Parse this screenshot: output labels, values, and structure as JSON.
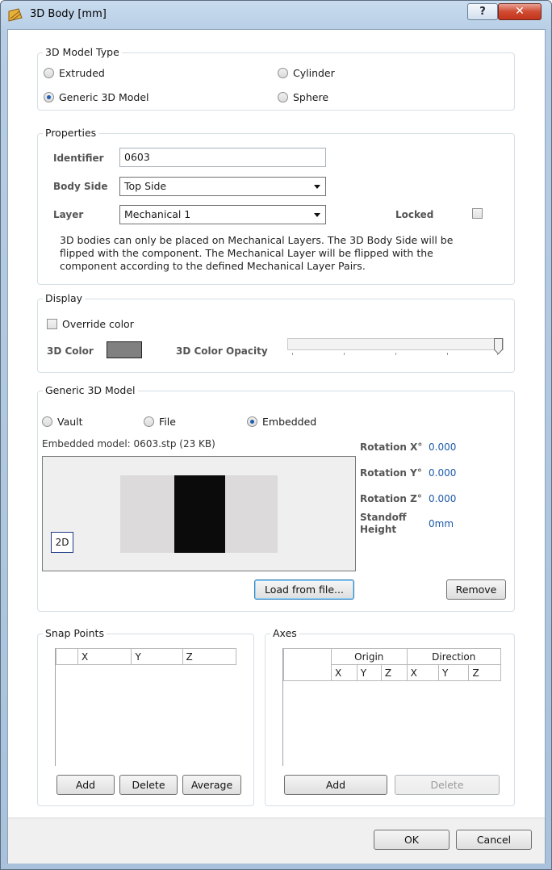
{
  "window": {
    "title": "3D Body [mm]",
    "help_label": "?",
    "close_label": "✕"
  },
  "model_type": {
    "legend": "3D Model Type",
    "options": [
      "Extruded",
      "Cylinder",
      "Generic 3D Model",
      "Sphere"
    ],
    "selected": "Generic 3D Model"
  },
  "properties": {
    "legend": "Properties",
    "identifier_label": "Identifier",
    "identifier_value": "0603",
    "body_side_label": "Body Side",
    "body_side_value": "Top Side",
    "layer_label": "Layer",
    "layer_value": "Mechanical 1",
    "locked_label": "Locked",
    "locked_checked": false,
    "note": "3D bodies can only be placed on Mechanical Layers. The 3D Body Side will be flipped with the component. The Mechanical Layer will be flipped with the component according to the defined Mechanical Layer Pairs."
  },
  "display": {
    "legend": "Display",
    "override_label": "Override color",
    "override_checked": false,
    "color_label": "3D Color",
    "color_value": "#808080",
    "opacity_label": "3D Color Opacity",
    "opacity_level": 1.0
  },
  "generic": {
    "legend": "Generic 3D Model",
    "source_options": [
      "Vault",
      "File",
      "Embedded"
    ],
    "selected_source": "Embedded",
    "embedded_caption": "Embedded model:  0603.stp (23 KB)",
    "preview_badge": "2D",
    "rotation_x_label": "Rotation X°",
    "rotation_x_value": "0.000",
    "rotation_y_label": "Rotation Y°",
    "rotation_y_value": "0.000",
    "rotation_z_label": "Rotation Z°",
    "rotation_z_value": "0.000",
    "standoff_label": "Standoff Height",
    "standoff_value": "0mm",
    "load_button": "Load from file...",
    "remove_button": "Remove"
  },
  "snap_points": {
    "legend": "Snap Points",
    "columns": [
      "X",
      "Y",
      "Z"
    ],
    "add_button": "Add",
    "delete_button": "Delete",
    "average_button": "Average"
  },
  "axes": {
    "legend": "Axes",
    "group_origin": "Origin",
    "group_direction": "Direction",
    "columns": [
      "X",
      "Y",
      "Z",
      "X",
      "Y",
      "Z"
    ],
    "add_button": "Add",
    "delete_button": "Delete"
  },
  "footer": {
    "ok_button": "OK",
    "cancel_button": "Cancel"
  },
  "colors": {
    "accent": "#1c5fb3",
    "value_blue": "#1d5aa8"
  }
}
